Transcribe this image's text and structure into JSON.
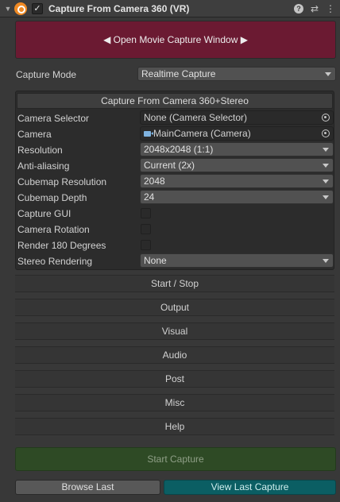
{
  "header": {
    "title": "Capture From Camera 360 (VR)",
    "enabled_mark": "✓",
    "foldout_glyph": "▼",
    "icons": [
      "help-icon",
      "presets-icon",
      "context-menu-icon"
    ]
  },
  "open_window_button": {
    "label": "◀ Open Movie Capture Window ▶"
  },
  "capture_mode": {
    "label": "Capture Mode",
    "value": "Realtime Capture"
  },
  "panel": {
    "title": "Capture From Camera 360+Stereo",
    "camera_selector": {
      "label": "Camera Selector",
      "value": "None (Camera Selector)"
    },
    "camera": {
      "label": "Camera",
      "value": "MainCamera (Camera)"
    },
    "resolution": {
      "label": "Resolution",
      "value": "2048x2048 (1:1)"
    },
    "anti_aliasing": {
      "label": "Anti-aliasing",
      "value": "Current (2x)"
    },
    "cubemap_resolution": {
      "label": "Cubemap Resolution",
      "value": "2048"
    },
    "cubemap_depth": {
      "label": "Cubemap Depth",
      "value": "24"
    },
    "capture_gui": {
      "label": "Capture GUI",
      "checked": false
    },
    "camera_rotation": {
      "label": "Camera Rotation",
      "checked": false
    },
    "render_180": {
      "label": "Render 180 Degrees",
      "checked": false
    },
    "stereo_rendering": {
      "label": "Stereo Rendering",
      "value": "None"
    }
  },
  "sections": [
    "Start / Stop",
    "Output",
    "Visual",
    "Audio",
    "Post",
    "Misc",
    "Help"
  ],
  "start_capture": {
    "label": "Start Capture"
  },
  "browse_last": {
    "label": "Browse Last"
  },
  "view_last_capture": {
    "label": "View Last Capture"
  },
  "colors": {
    "background": "#383838",
    "open_window_button": "#6b1a32",
    "start_capture": "#2e4a25",
    "view_last_capture": "#0b5e63",
    "component_icon": "#f08a24"
  }
}
